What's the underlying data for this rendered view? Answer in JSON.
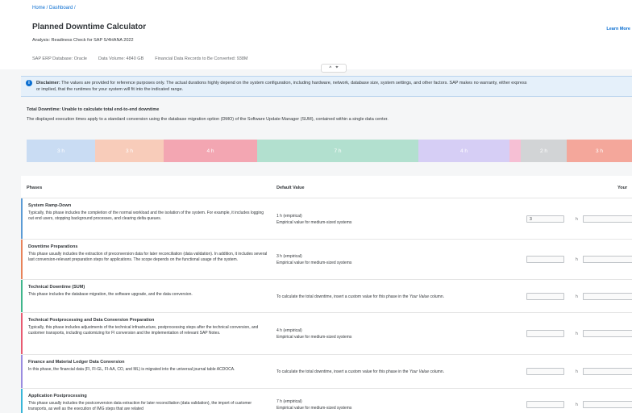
{
  "header": {
    "breadcrumb": "Home / Dashboard /",
    "title": "Planned Downtime Calculator",
    "subtitle": "Analysis: Readiness Check for SAP S/4HANA 2022",
    "learn_more": "Learn More",
    "meta": [
      "SAP ERP Database: Oracle",
      "Data Volume: 4840 GB",
      "Financial Data Records to Be Converted: 938M"
    ],
    "collapse_icon": "^",
    "pin_icon": "⌖"
  },
  "disclaimer": {
    "label": "Disclaimer:",
    "line1": " The values are provided for reference purposes only. The actual durations highly depend on the system configuration, including hardware, network, database size, system settings, and other factors. SAP makes no warranty, either express",
    "line2": "or implied, that the runtimes for your system will fit into the indicated range.",
    "icon": "i"
  },
  "total": {
    "title": "Total Downtime: Unable to calculate total end-to-end downtime",
    "description": "The displayed execution times apply to a standard conversion using the database migration option (DMO) of the Software Update Manager (SUM), contained within a single data center."
  },
  "timeline": [
    {
      "label": "3 h",
      "color": "#c9dcf3",
      "weight": 85
    },
    {
      "label": "3 h",
      "color": "#f8ccba",
      "weight": 85
    },
    {
      "label": "4 h",
      "color": "#f3a6b2",
      "weight": 116
    },
    {
      "label": "7 h",
      "color": "#b2e0cf",
      "weight": 200
    },
    {
      "label": "4 h",
      "color": "#d6cef5",
      "weight": 113
    },
    {
      "label": "",
      "color": "#f6bfd4",
      "weight": 14
    },
    {
      "label": "2 h",
      "color": "#d2d4d6",
      "weight": 57
    },
    {
      "label": "3 h",
      "color": "#f4a79b",
      "weight": 81
    }
  ],
  "table": {
    "col_phases": "Phases",
    "col_default": "Default Value",
    "col_your": "Your",
    "unit": "h",
    "rows": [
      {
        "title": "System Ramp-Down",
        "desc": "Typically, this phase includes the completion of the normal workload and the isolation of the system. For example, it includes logging out end users, stopping background processes, and clearing delta queues.",
        "default_main": "1 h (empirical)",
        "default_sub": "Empirical value for medium-sized systems",
        "value": "3",
        "color": "#5b9bd5"
      },
      {
        "title": "Downtime Preparations",
        "desc": "This phase usually includes the extraction of preconversion data for later reconciliation (data validation). In addition, it includes several last conversion-relevant preparation steps for applications. The scope depends on the functional usage of the system.",
        "default_main": "3 h (empirical)",
        "default_sub": "Empirical value for medium-sized systems",
        "value": "",
        "color": "#e8835a"
      },
      {
        "title": "Technical Downtime (SUM)",
        "desc": "This phase includes the database migration, the software upgrade, and the data conversion.",
        "default_main": "To calculate the total downtime, insert a custom value for this phase in the ",
        "default_main_em": "Your Value",
        "default_main_end": " column.",
        "default_sub": "",
        "value": "",
        "color": "#3fb68b"
      },
      {
        "title": "Technical Postprocessing and Data Conversion Preparation",
        "desc": "Typically, this phase includes adjustments of the technical infrastructure, postprocessing steps after the technical conversion, and customer transports, including customizing for FI conversion and the implementation of relevant SAP Notes.",
        "default_main": "4 h (empirical)",
        "default_sub": "Empirical value for medium-sized systems",
        "value": "",
        "color": "#e85a71"
      },
      {
        "title": "Finance and Material Ledger Data Conversion",
        "desc": "In this phase, the financial data (FI, FI-GL, FI-AA, CO, and ML) is migrated into the universal journal table ACDOCA.",
        "default_main": "To calculate the total downtime, insert a custom value for this phase in the ",
        "default_main_em": "Your Value",
        "default_main_end": " column.",
        "default_sub": "",
        "value": "",
        "color": "#9a8ce0"
      },
      {
        "title": "Application Postprocessing",
        "desc": "This phase usually includes the postconversion data extraction for later reconciliation (data validation), the import of customer transports, as well as the execution of IMG steps that are related",
        "default_main": "7 h (empirical)",
        "default_sub": "Empirical value for medium-sized systems",
        "value": "",
        "color": "#38b6d8"
      }
    ]
  }
}
